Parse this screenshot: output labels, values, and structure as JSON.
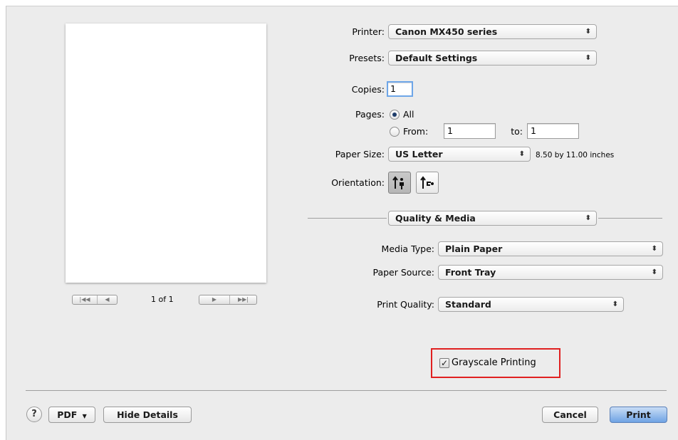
{
  "preview": {
    "first_glyph": "|◀◀",
    "prev_glyph": "◀",
    "page_count": "1 of 1",
    "next_glyph": "▶",
    "last_glyph": "▶▶|"
  },
  "printer": {
    "label": "Printer:",
    "value": "Canon MX450 series"
  },
  "presets": {
    "label": "Presets:",
    "value": "Default Settings"
  },
  "copies": {
    "label": "Copies:",
    "value": "1"
  },
  "pages": {
    "label": "Pages:",
    "all_label": "All",
    "from_label": "From:",
    "from_value": "1",
    "to_label": "to:",
    "to_value": "1",
    "selected": "All"
  },
  "paper_size": {
    "label": "Paper Size:",
    "value": "US Letter",
    "dimensions": "8.50 by 11.00 inches"
  },
  "orientation": {
    "label": "Orientation:",
    "selected": "portrait"
  },
  "section_popup": {
    "value": "Quality & Media"
  },
  "media_type": {
    "label": "Media Type:",
    "value": "Plain Paper"
  },
  "paper_source": {
    "label": "Paper Source:",
    "value": "Front Tray"
  },
  "print_quality": {
    "label": "Print Quality:",
    "value": "Standard"
  },
  "grayscale": {
    "label": "Grayscale Printing",
    "checked": true
  },
  "footer": {
    "help": "?",
    "pdf_label": "PDF",
    "hide_details_label": "Hide Details",
    "cancel_label": "Cancel",
    "print_label": "Print"
  },
  "popup_arrows": "⬍",
  "colors": {
    "highlight": "#e02020",
    "default_button": "#6fa3e4"
  }
}
